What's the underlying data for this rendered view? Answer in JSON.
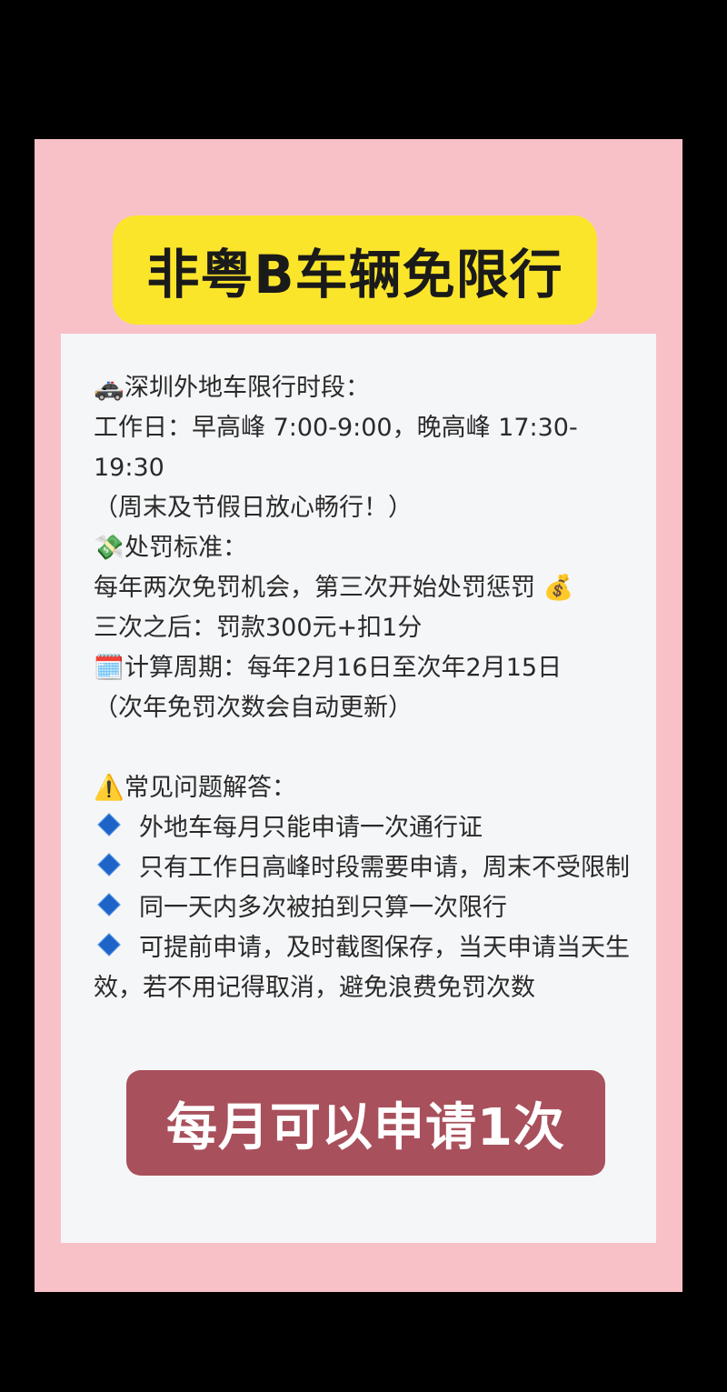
{
  "title": "非粤B车辆免限行",
  "sections": {
    "period": {
      "icon": "🚓",
      "icon_name": "police-car-icon",
      "heading": "深圳外地车限行时段：",
      "line1": "工作日：早高峰 7:00-9:00，晚高峰 17:30-",
      "line2": "19:30",
      "line3": "（周末及节假日放心畅行！）"
    },
    "penalty": {
      "icon": "💸",
      "icon_name": "money-with-wings-icon",
      "heading": "处罚标准：",
      "line1": "每年两次免罚机会，第三次开始处罚惩罚",
      "line1_icon": "💰",
      "line1_icon_name": "money-bag-icon",
      "line2": "三次之后：罚款300元+扣1分"
    },
    "cycle": {
      "icon": "🗓️",
      "icon_name": "calendar-icon",
      "heading": "计算周期：每年2月16日至次年2月15日",
      "line1": "（次年免罚次数会自动更新）"
    },
    "faq": {
      "icon": "⚠️",
      "icon_name": "warning-icon",
      "heading": "常见问题解答：",
      "items": [
        "外地车每月只能申请一次通行证",
        "只有工作日高峰时段需要申请，周末不受限制",
        "同一天内多次被拍到只算一次限行",
        "可提前申请，及时截图保存，当天申请当天生效，若不用记得取消，避免浪费免罚次数"
      ]
    }
  },
  "footer": "每月可以申请1次",
  "colors": {
    "background": "#000000",
    "frame": "#f8c1c8",
    "title_bg": "#fbe52b",
    "card_bg": "#f5f6f8",
    "footer_bg": "#a8505c",
    "bullet": "#1d63c8"
  }
}
